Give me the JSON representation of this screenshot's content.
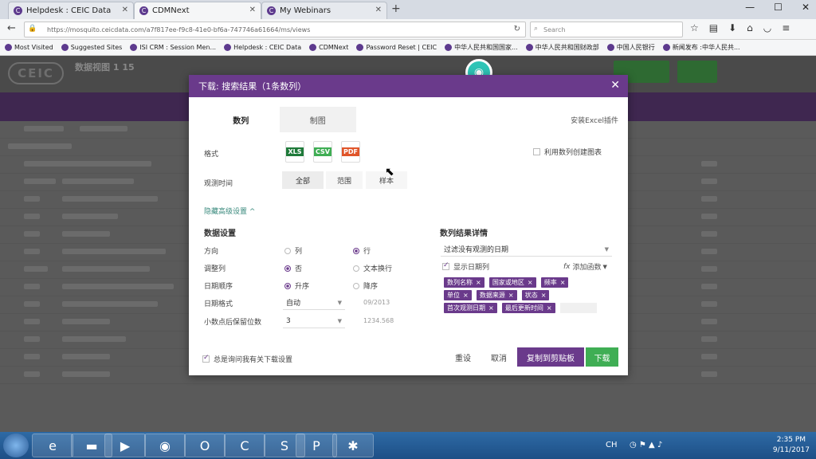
{
  "browser": {
    "tabs": [
      {
        "label": "Helpdesk : CEIC Data"
      },
      {
        "label": "CDMNext"
      },
      {
        "label": "My Webinars"
      }
    ],
    "url": "https://mosquito.ceicdata.com/a7f817ee-f9c8-41e0-bf6a-747746a61664/ms/views",
    "search_placeholder": "Search",
    "bookmarks": [
      "Most Visited",
      "Suggested Sites",
      "ISI CRM : Session Men...",
      "Helpdesk : CEIC Data",
      "CDMNext",
      "Password Reset | CEIC",
      "中华人民共和国国家...",
      "中华人民共和国财政部",
      "中国人民银行",
      "新闻发布 :中华人民共..."
    ]
  },
  "app": {
    "logo": "CEIC",
    "header_title": "数据视图 1 15"
  },
  "dialog": {
    "title": "下载: 搜索结果（1条数列）",
    "tabs": [
      "数列",
      "制图"
    ],
    "excel_plugin": "安装Excel插件",
    "format_label": "格式",
    "formats": [
      "XLS",
      "CSV",
      "PDF"
    ],
    "create_chart": "利用数列创建图表",
    "obs_label": "观测时间",
    "obs_options": [
      "全部",
      "范围",
      "样本"
    ],
    "advanced": "隐藏高级设置 ^",
    "data_settings": {
      "title": "数据设置",
      "direction_label": "方向",
      "dir_col": "列",
      "dir_row": "行",
      "adjust_label": "调整列",
      "adjust_no": "否",
      "adjust_wrap": "文本换行",
      "order_label": "日期顺序",
      "order_asc": "升序",
      "order_desc": "降序",
      "datefmt_label": "日期格式",
      "datefmt_value": "自动",
      "datefmt_sample": "09/2013",
      "decimals_label": "小数点后保留位数",
      "decimals_value": "3",
      "decimals_sample": "1234.568"
    },
    "details": {
      "title": "数列结果详情",
      "filter_value": "过滤没有观测的日期",
      "show_date": "显示日期列",
      "add_func": "添加函数",
      "tags": [
        "数列名称",
        "国家或地区",
        "频率",
        "单位",
        "数据来源",
        "状态",
        "首次观测日期",
        "最后更新时间"
      ]
    },
    "remember": "总是询问我有关下载设置",
    "buttons": {
      "reset": "重设",
      "cancel": "取消",
      "copy": "复制到剪贴板",
      "download": "下载"
    }
  },
  "taskbar": {
    "lang": "CH",
    "time": "2:35 PM",
    "date": "9/11/2017"
  }
}
